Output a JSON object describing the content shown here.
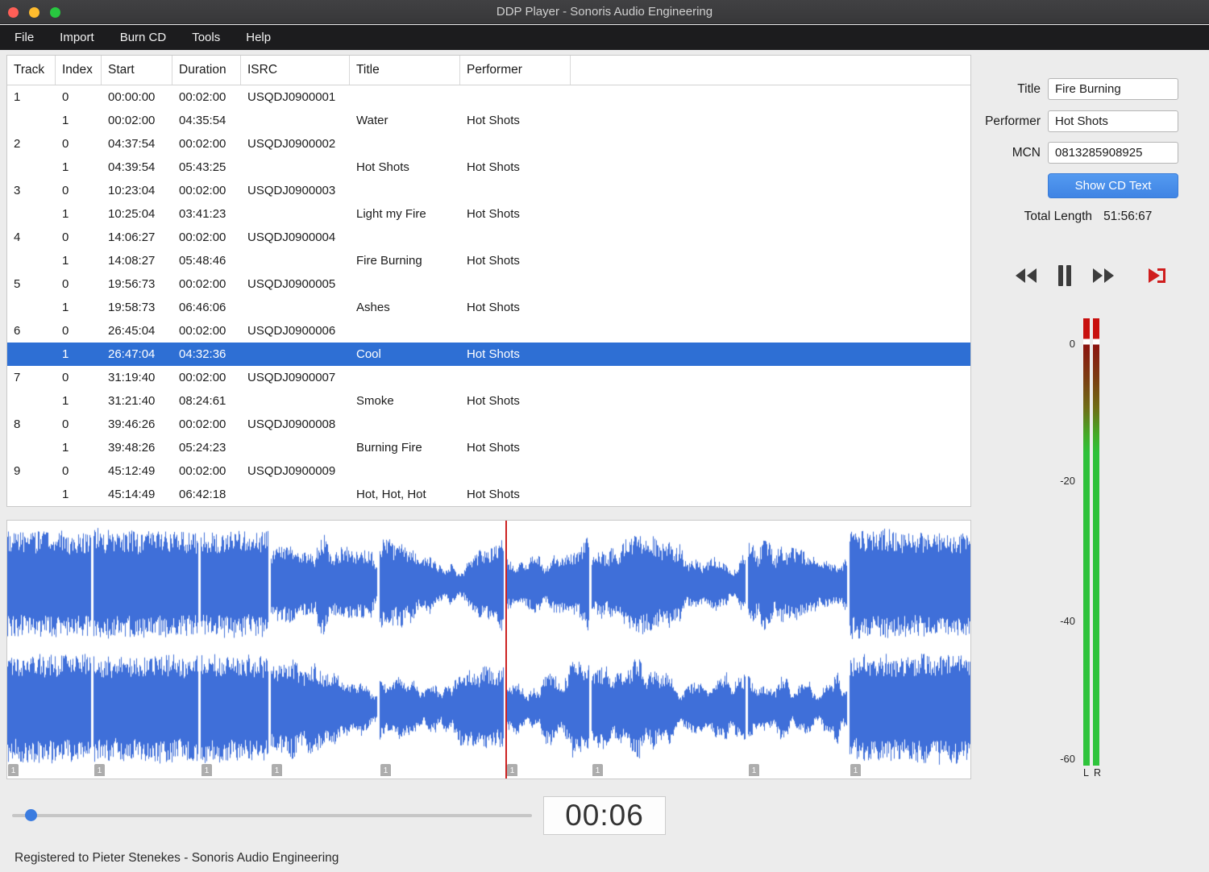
{
  "window": {
    "title": "DDP Player - Sonoris Audio Engineering",
    "menus": [
      "File",
      "Import",
      "Burn CD",
      "Tools",
      "Help"
    ]
  },
  "track_table": {
    "columns": [
      "Track",
      "Index",
      "Start",
      "Duration",
      "ISRC",
      "Title",
      "Performer"
    ],
    "rows": [
      {
        "cells": [
          "1",
          "0",
          "00:00:00",
          "00:02:00",
          "USQDJ0900001",
          "",
          ""
        ],
        "selected": false
      },
      {
        "cells": [
          "",
          "1",
          "00:02:00",
          "04:35:54",
          "",
          "Water",
          "Hot Shots"
        ],
        "selected": false
      },
      {
        "cells": [
          "2",
          "0",
          "04:37:54",
          "00:02:00",
          "USQDJ0900002",
          "",
          ""
        ],
        "selected": false
      },
      {
        "cells": [
          "",
          "1",
          "04:39:54",
          "05:43:25",
          "",
          "Hot Shots",
          "Hot Shots"
        ],
        "selected": false
      },
      {
        "cells": [
          "3",
          "0",
          "10:23:04",
          "00:02:00",
          "USQDJ0900003",
          "",
          ""
        ],
        "selected": false
      },
      {
        "cells": [
          "",
          "1",
          "10:25:04",
          "03:41:23",
          "",
          "Light my Fire",
          "Hot Shots"
        ],
        "selected": false
      },
      {
        "cells": [
          "4",
          "0",
          "14:06:27",
          "00:02:00",
          "USQDJ0900004",
          "",
          ""
        ],
        "selected": false
      },
      {
        "cells": [
          "",
          "1",
          "14:08:27",
          "05:48:46",
          "",
          "Fire Burning",
          "Hot Shots"
        ],
        "selected": false
      },
      {
        "cells": [
          "5",
          "0",
          "19:56:73",
          "00:02:00",
          "USQDJ0900005",
          "",
          ""
        ],
        "selected": false
      },
      {
        "cells": [
          "",
          "1",
          "19:58:73",
          "06:46:06",
          "",
          "Ashes",
          "Hot Shots"
        ],
        "selected": false
      },
      {
        "cells": [
          "6",
          "0",
          "26:45:04",
          "00:02:00",
          "USQDJ0900006",
          "",
          ""
        ],
        "selected": false
      },
      {
        "cells": [
          "",
          "1",
          "26:47:04",
          "04:32:36",
          "",
          "Cool",
          "Hot Shots"
        ],
        "selected": true
      },
      {
        "cells": [
          "7",
          "0",
          "31:19:40",
          "00:02:00",
          "USQDJ0900007",
          "",
          ""
        ],
        "selected": false
      },
      {
        "cells": [
          "",
          "1",
          "31:21:40",
          "08:24:61",
          "",
          "Smoke",
          "Hot Shots"
        ],
        "selected": false
      },
      {
        "cells": [
          "8",
          "0",
          "39:46:26",
          "00:02:00",
          "USQDJ0900008",
          "",
          ""
        ],
        "selected": false
      },
      {
        "cells": [
          "",
          "1",
          "39:48:26",
          "05:24:23",
          "",
          "Burning Fire",
          "Hot Shots"
        ],
        "selected": false
      },
      {
        "cells": [
          "9",
          "0",
          "45:12:49",
          "00:02:00",
          "USQDJ0900009",
          "",
          ""
        ],
        "selected": false
      },
      {
        "cells": [
          "",
          "1",
          "45:14:49",
          "06:42:18",
          "",
          "Hot, Hot, Hot",
          "Hot Shots"
        ],
        "selected": false
      }
    ]
  },
  "cd_text_panel": {
    "fields": [
      {
        "name": "title",
        "label": "Title",
        "value": "Fire Burning"
      },
      {
        "name": "performer",
        "label": "Performer",
        "value": "Hot Shots"
      },
      {
        "name": "mcn",
        "label": "MCN",
        "value": "0813285908925"
      }
    ],
    "show_cd_text_button": "Show CD Text",
    "total_length_label": "Total Length",
    "total_length_value": "51:56:67"
  },
  "transport": {
    "buttons": [
      "rewind",
      "pause",
      "fast-forward",
      "play-to-marker"
    ],
    "time_display": "00:06"
  },
  "level_meter": {
    "scale_labels": [
      "0",
      "-20",
      "-40",
      "-60"
    ],
    "channel_labels": [
      "L",
      "R"
    ]
  },
  "waveform": {
    "segment_durations_seconds": [
      275,
      343,
      221,
      348,
      406,
      272,
      504,
      324,
      402
    ],
    "segment_profiles": [
      "full",
      "full",
      "full",
      "dynamic",
      "dynamic",
      "dynamic",
      "dynamic",
      "dynamic",
      "full"
    ],
    "marker_label": "1",
    "playhead_segment_index": 5,
    "waveform_color": "#3f6fd9",
    "cursor_color": "#cc2222"
  },
  "seek_slider": {
    "fraction": 0.035
  },
  "status_bar": {
    "text": "Registered to Pieter Stenekes - Sonoris Audio Engineering"
  },
  "colors": {
    "selection": "#2e6fd4",
    "accent_button": "#4a90e2"
  }
}
